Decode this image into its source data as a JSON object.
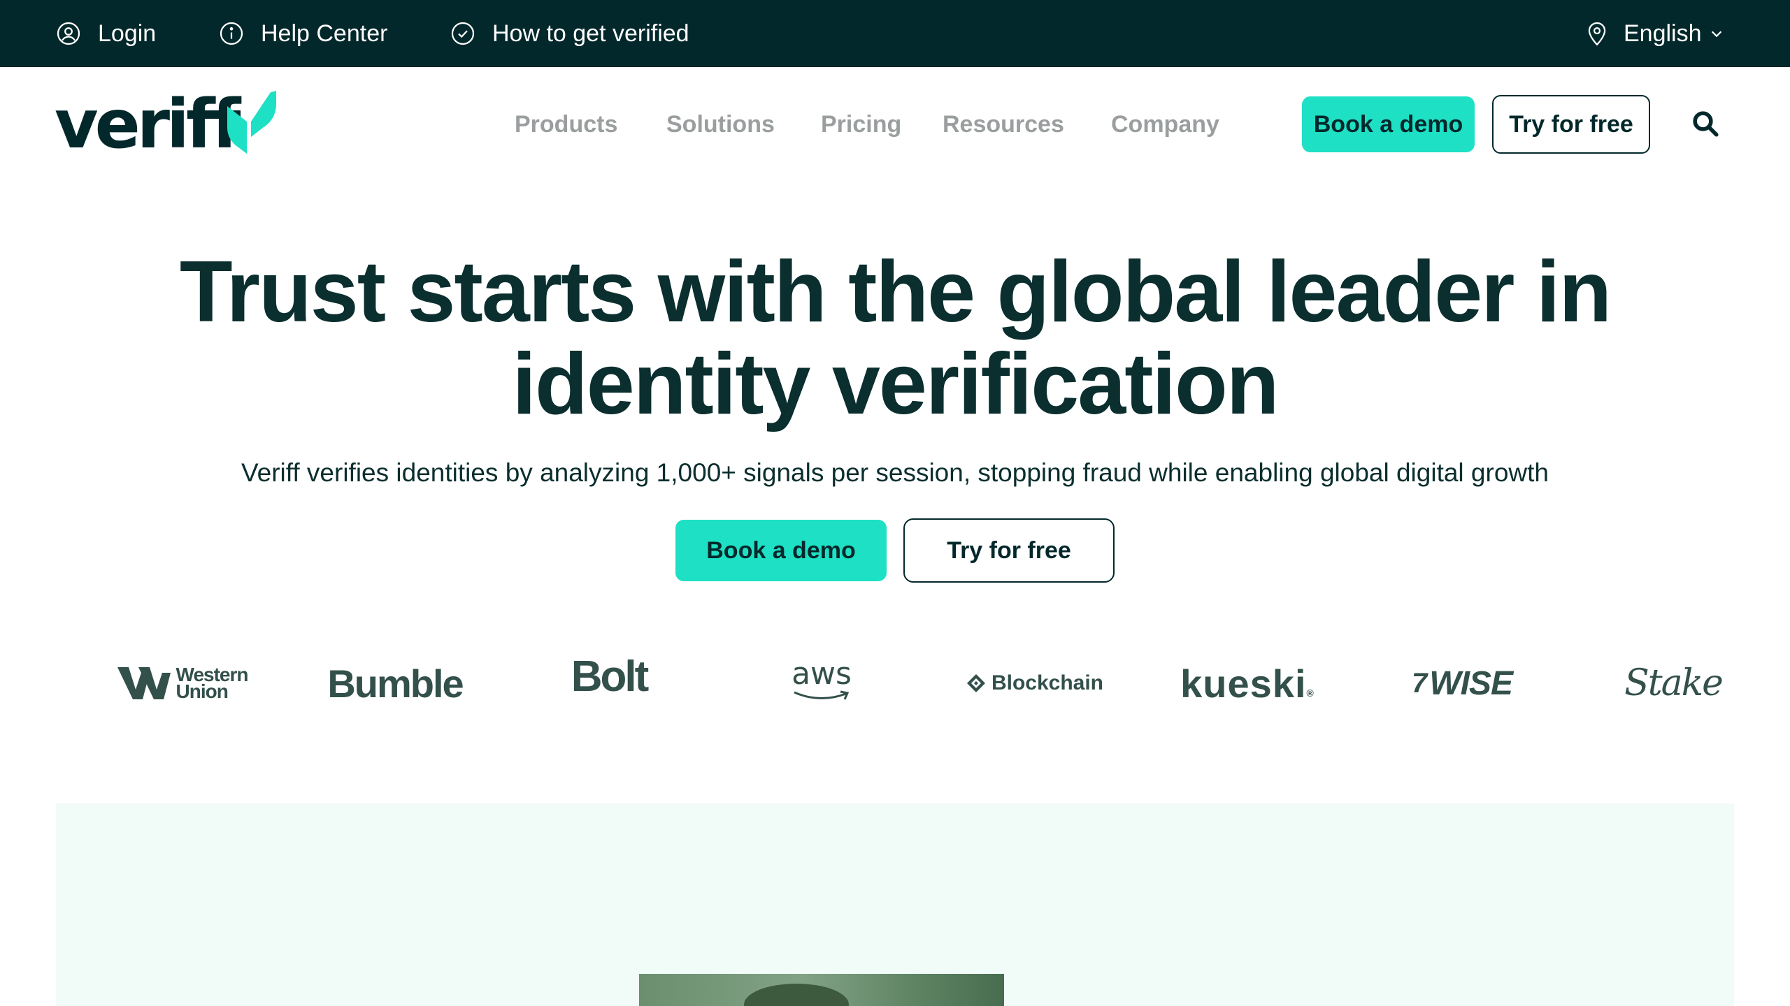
{
  "topbar": {
    "login": "Login",
    "help": "Help Center",
    "verified": "How to get verified",
    "language": "English"
  },
  "logo": {
    "text": "veriff"
  },
  "nav": {
    "items": [
      "Products",
      "Solutions",
      "Pricing",
      "Resources",
      "Company"
    ],
    "book_demo": "Book a demo",
    "try_free": "Try for free"
  },
  "hero": {
    "title_line1": "Trust starts with the global leader in",
    "title_line2": "identity verification",
    "subtitle": "Veriff verifies identities by analyzing 1,000+ signals per session, stopping fraud while enabling global digital growth",
    "book_demo": "Book a demo",
    "try_free": "Try for free"
  },
  "brands": {
    "western_union_line1": "Western",
    "western_union_line2": "Union",
    "bumble": "Bumble",
    "bolt": "Bolt",
    "aws": "aws",
    "blockchain": "Blockchain",
    "kueski": "kueski",
    "kueski_mark": "®",
    "wise": "WISE",
    "wise_mark": "7",
    "stake": "Stake"
  },
  "colors": {
    "topbar_bg": "#03282b",
    "accent": "#1ee0c5",
    "text_dark": "#0b2e2e",
    "nav_gray": "#9a9e9e",
    "panel_bg": "#f1fbf8"
  }
}
